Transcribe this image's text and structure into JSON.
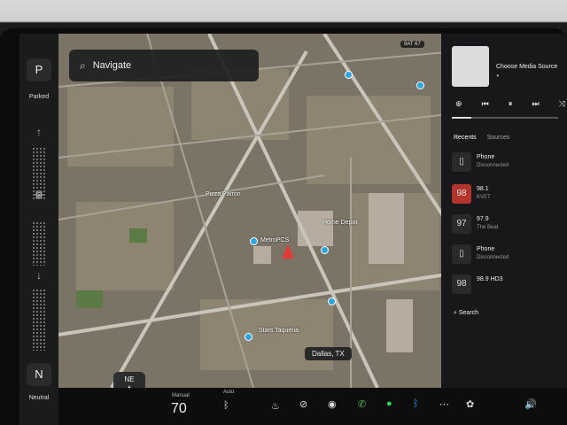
{
  "gear": {
    "park": "P",
    "parked_label": "Parked",
    "neutral": "N",
    "neutral_label": "Neutral"
  },
  "search": {
    "placeholder": "Navigate",
    "icon": "search-icon"
  },
  "map": {
    "status_chip": "9AT 67",
    "city_chip": "Dallas, TX",
    "compass": "NE",
    "labels": [
      "Pizza Patron",
      "MetroPCS",
      "Home Depot",
      "Stars Taqueria"
    ],
    "accent": "#2aa5e0",
    "vehicle_color": "#e23b3b"
  },
  "media": {
    "source_title": "Choose Media Source",
    "source_sub": "●",
    "tabs": {
      "recents": "Recents",
      "sources": "Sources"
    },
    "stations": [
      {
        "name": "Phone",
        "sub": "Disconnected",
        "logo": "▯"
      },
      {
        "name": "98.1",
        "sub": "KVET",
        "logo": "98"
      },
      {
        "name": "97.9",
        "sub": "The Beat",
        "logo": "97"
      },
      {
        "name": "Phone",
        "sub": "Disconnected",
        "logo": "▯"
      },
      {
        "name": "98.9 HD3",
        "sub": "",
        "logo": "98"
      }
    ],
    "search_label": "Search",
    "progress": 0.18
  },
  "bottom": {
    "climate_label": "Manual",
    "temp": "70",
    "auto_label": "Auto"
  }
}
